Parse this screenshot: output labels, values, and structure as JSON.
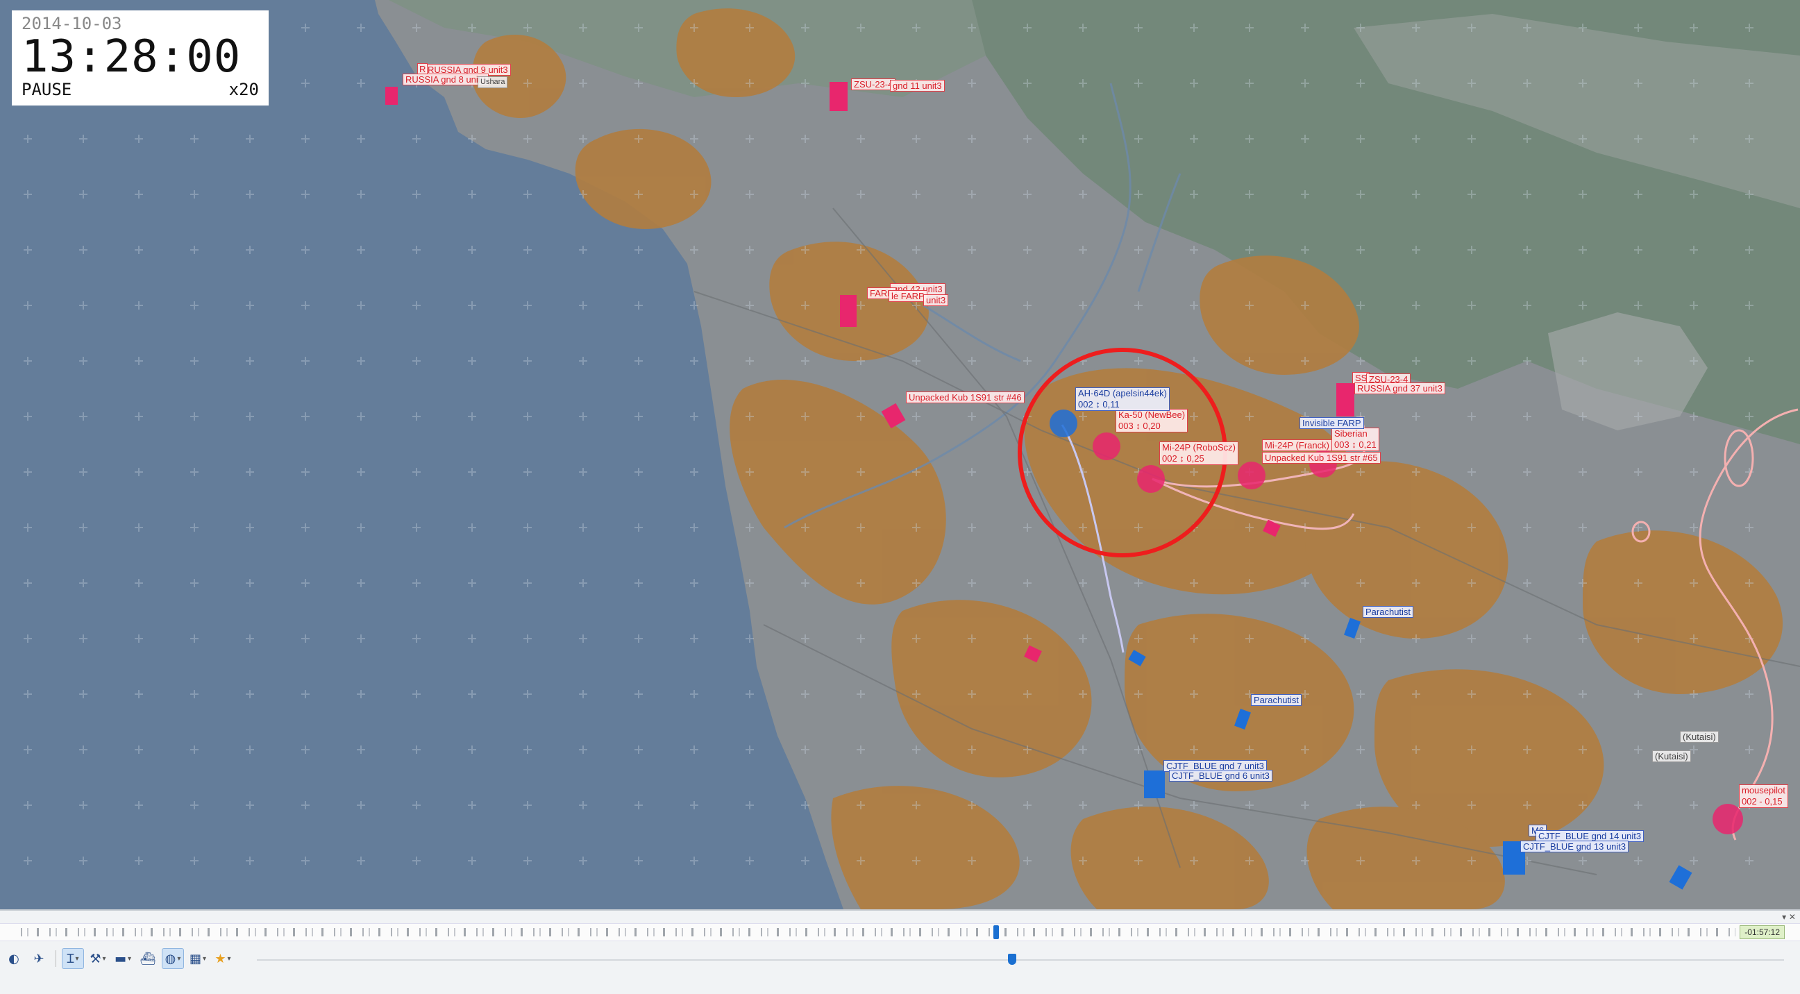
{
  "clock": {
    "date": "2014-10-03",
    "time": "13:28:00",
    "state": "PAUSE",
    "speed": "x20"
  },
  "units": {
    "r1": "RUSSIA gnd 9 unit3",
    "r2": "RUSSIA gnd 8 unit3",
    "r2b": "R",
    "r3": "ZSU-23-4",
    "r4": "gnd 11 unit3",
    "r5": "gnd 42 unit3",
    "r6": "FARP",
    "r7": "le FARP",
    "r8": "unit3",
    "r9": "Unpacked Kub 1S91 str #46",
    "r10": "SS",
    "r11": "ZSU-23-4",
    "r12": "RUSSIA gnd 37 unit3",
    "r13": "Ka-50 (NewBee)",
    "r13b": "003 ↕ 0,20",
    "r14": "Mi-24P (RoboScz)",
    "r14b": "002 ↕ 0,25",
    "r15": "Mi-24P (Franck)",
    "r16": "Siberian",
    "r16b": "003 ↕ 0,21",
    "r16c": "Unpacked Kub 1S91 str #65",
    "r17": "mousepilot",
    "r17b": "002 - 0,15",
    "b1": "AH-64D (apelsin44ek)",
    "b1b": "002 ↕ 0,11",
    "b2": "Invisible FARP",
    "b3": "Parachutist",
    "b4": "Parachutist",
    "b5": "CJTF_BLUE gnd 7 unit3",
    "b6": "CJTF_BLUE gnd 6 unit3",
    "b7": "CJTF_BLUE gnd 14 unit3",
    "b8": "CJTF_BLUE gnd 13 unit3",
    "b9": "M6",
    "g1": "(Kutaisi)",
    "g2": "(Kutaisi)",
    "g3": "Ushara"
  },
  "timeline": {
    "time_offset": "-01:57:12",
    "cursor_fraction": 0.57
  },
  "toolbar": {
    "icons": [
      "unit-icon",
      "plane-icon",
      "text-cursor-icon",
      "tool-icon",
      "vehicle-icon",
      "ship-icon",
      "globe-icon",
      "grid-icon",
      "star-icon"
    ]
  },
  "colors": {
    "sea": "#647d9a",
    "land": "#8a8f93",
    "forest": "#7b8f80",
    "farmland": "#b17d3f",
    "red": "#e8266d",
    "blue": "#1e6fd8",
    "highlight": "#ee1d1d"
  }
}
